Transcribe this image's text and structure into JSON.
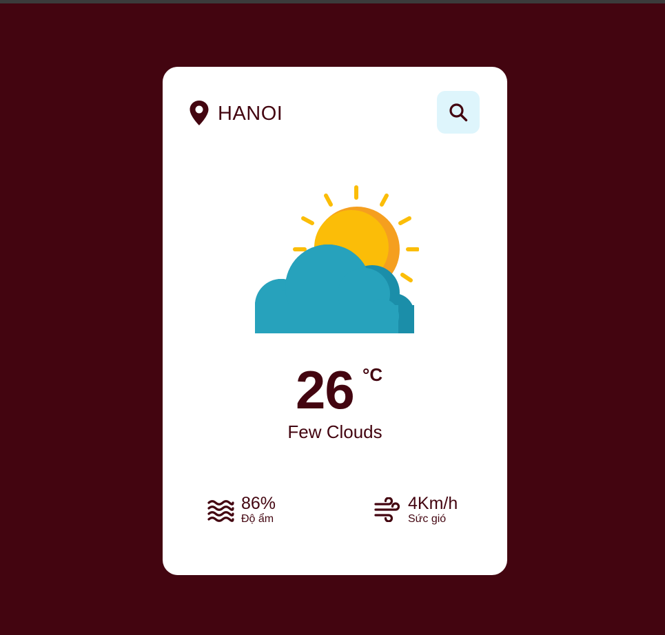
{
  "location": {
    "icon": "map-pin-icon",
    "city": "HANOI"
  },
  "search": {
    "icon": "search-icon"
  },
  "weather": {
    "icon": "sun-behind-cloud-icon",
    "temperature": "26",
    "unit": "°C",
    "description": "Few Clouds"
  },
  "stats": {
    "humidity": {
      "icon": "waves-icon",
      "value": "86%",
      "label": "Độ ẩm"
    },
    "wind": {
      "icon": "wind-icon",
      "value": "4Km/h",
      "label": "Sức gió"
    }
  },
  "colors": {
    "background": "#430510",
    "card": "#ffffff",
    "text": "#430510",
    "search_bg": "#def5fc",
    "sun": "#fbbd08",
    "sun_shade": "#f59f1f",
    "cloud": "#27a2bc",
    "cloud_shade": "#1b8ea9"
  }
}
